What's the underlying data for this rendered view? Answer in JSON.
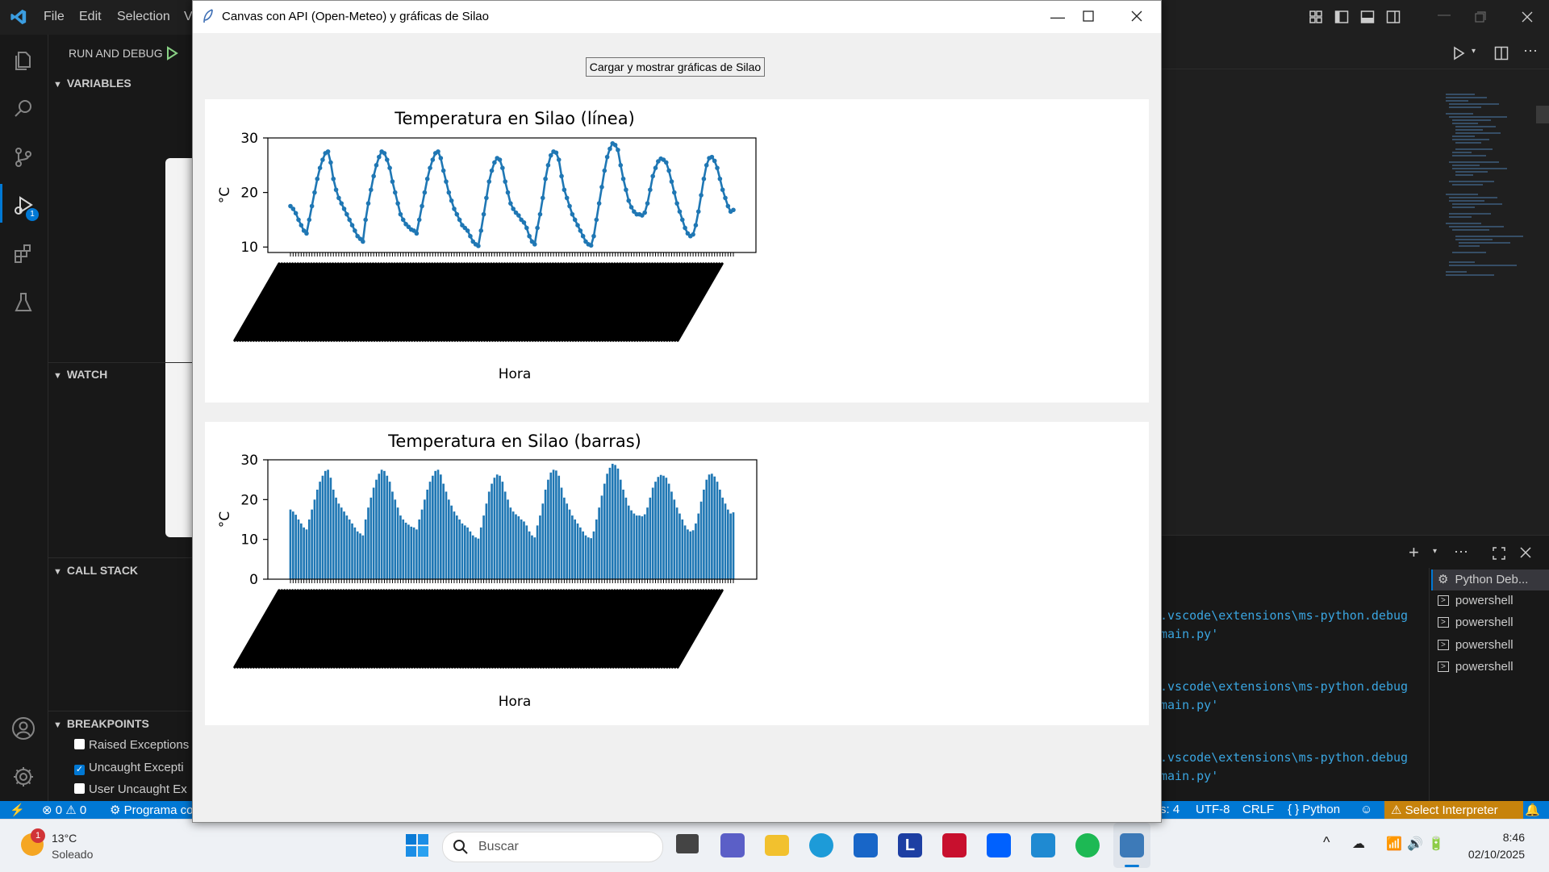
{
  "vscode": {
    "menu": [
      "File",
      "Edit",
      "Selection",
      "V"
    ],
    "run_debug_label": "RUN AND DEBUG",
    "sections": {
      "variables": "VARIABLES",
      "watch": "WATCH",
      "call_stack": "CALL STACK",
      "breakpoints": "BREAKPOINTS"
    },
    "breakpoints": [
      {
        "label": "Raised Exceptions",
        "checked": false
      },
      {
        "label": "Uncaught Excepti",
        "checked": true
      },
      {
        "label": "User Uncaught Ex",
        "checked": false
      }
    ],
    "debug_badge": "1",
    "terminal_lines": [
      ".vscode\\extensions\\ms-python.debug",
      "main.py'",
      ".vscode\\extensions\\ms-python.debug",
      "main.py'",
      ".vscode\\extensions\\ms-python.debug",
      "main.py'"
    ],
    "terminals": [
      "Python Deb...",
      "powershell",
      "powershell",
      "powershell",
      "powershell"
    ],
    "status": {
      "errors": "0",
      "warnings": "0",
      "program": "Programa co",
      "spaces": "s: 4",
      "encoding": "UTF-8",
      "eol": "CRLF",
      "language": "Python",
      "interpreter": "Select Interpreter"
    }
  },
  "tk_window": {
    "title": "Canvas con API (Open-Meteo) y gráficas de Silao",
    "button_label": "Cargar y mostrar gráficas de Silao"
  },
  "taskbar": {
    "weather_temp": "13°C",
    "weather_desc": "Soleado",
    "weather_badge": "1",
    "search_placeholder": "Buscar",
    "time": "8:46",
    "date": "02/10/2025"
  },
  "chart_data": [
    {
      "type": "line",
      "title": "Temperatura en Silao (línea)",
      "xlabel": "Hora",
      "ylabel": "°C",
      "ylim": [
        9,
        30
      ],
      "yticks": [
        10,
        20,
        30
      ],
      "series": [
        {
          "values": [
            17.5,
            17,
            16.2,
            15,
            14,
            13,
            12.5,
            15,
            17.5,
            20,
            22.5,
            24.5,
            26,
            27.2,
            27.5,
            25.5,
            22.5,
            20.5,
            19,
            18,
            17,
            16,
            15,
            14,
            13,
            12,
            11.5,
            11,
            15,
            18,
            20.5,
            23,
            25,
            26.5,
            27.5,
            27.2,
            26,
            24.5,
            22,
            20,
            18,
            16,
            15,
            14.2,
            13.7,
            13.2,
            13,
            12.5,
            15,
            17.5,
            20,
            22.5,
            24.5,
            26,
            27.2,
            27.5,
            26.3,
            24,
            22,
            20,
            18.5,
            17,
            16,
            15,
            14,
            13.5,
            13,
            12,
            11,
            10.5,
            10.2,
            13,
            16,
            19,
            22,
            24,
            25.5,
            26.3,
            26,
            24.5,
            22,
            20,
            18,
            17,
            16.3,
            15.8,
            15,
            14.5,
            13.5,
            12,
            11,
            10.5,
            13.5,
            16,
            19,
            22.5,
            25,
            26.8,
            27.5,
            27.3,
            26,
            23,
            20.5,
            19,
            17.5,
            16,
            15,
            14,
            13,
            12,
            11,
            10.5,
            10.3,
            12,
            15,
            18,
            21,
            24,
            26.5,
            28,
            29,
            28.7,
            27.8,
            25,
            22.5,
            20.5,
            18.5,
            17.3,
            16.5,
            16,
            16,
            15.8,
            16.3,
            18,
            20.5,
            23,
            24.5,
            25.7,
            26.2,
            26,
            25.5,
            24,
            22,
            20,
            18,
            16.5,
            15,
            13.5,
            12.5,
            12,
            12.3,
            14,
            16.5,
            19.5,
            22.5,
            25,
            26.3,
            26.5,
            25.8,
            24.5,
            22.5,
            20.5,
            19,
            17.5,
            16.5,
            16.8
          ]
        }
      ]
    },
    {
      "type": "bar",
      "title": "Temperatura en Silao (barras)",
      "xlabel": "Hora",
      "ylabel": "°C",
      "ylim": [
        0,
        30
      ],
      "yticks": [
        0,
        10,
        20,
        30
      ],
      "series": [
        {
          "values": [
            17.5,
            17,
            16.2,
            15,
            14,
            13,
            12.5,
            15,
            17.5,
            20,
            22.5,
            24.5,
            26,
            27.2,
            27.5,
            25.5,
            22.5,
            20.5,
            19,
            18,
            17,
            16,
            15,
            14,
            13,
            12,
            11.5,
            11,
            15,
            18,
            20.5,
            23,
            25,
            26.5,
            27.5,
            27.2,
            26,
            24.5,
            22,
            20,
            18,
            16,
            15,
            14.2,
            13.7,
            13.2,
            13,
            12.5,
            15,
            17.5,
            20,
            22.5,
            24.5,
            26,
            27.2,
            27.5,
            26.3,
            24,
            22,
            20,
            18.5,
            17,
            16,
            15,
            14,
            13.5,
            13,
            12,
            11,
            10.5,
            10.2,
            13,
            16,
            19,
            22,
            24,
            25.5,
            26.3,
            26,
            24.5,
            22,
            20,
            18,
            17,
            16.3,
            15.8,
            15,
            14.5,
            13.5,
            12,
            11,
            10.5,
            13.5,
            16,
            19,
            22.5,
            25,
            26.8,
            27.5,
            27.3,
            26,
            23,
            20.5,
            19,
            17.5,
            16,
            15,
            14,
            13,
            12,
            11,
            10.5,
            10.3,
            12,
            15,
            18,
            21,
            24,
            26.5,
            28,
            29,
            28.7,
            27.8,
            25,
            22.5,
            20.5,
            18.5,
            17.3,
            16.5,
            16,
            16,
            15.8,
            16.3,
            18,
            20.5,
            23,
            24.5,
            25.7,
            26.2,
            26,
            25.5,
            24,
            22,
            20,
            18,
            16.5,
            15,
            13.5,
            12.5,
            12,
            12.3,
            14,
            16.5,
            19.5,
            22.5,
            25,
            26.3,
            26.5,
            25.8,
            24.5,
            22.5,
            20.5,
            19,
            17.5,
            16.5,
            16.8
          ]
        }
      ]
    }
  ]
}
